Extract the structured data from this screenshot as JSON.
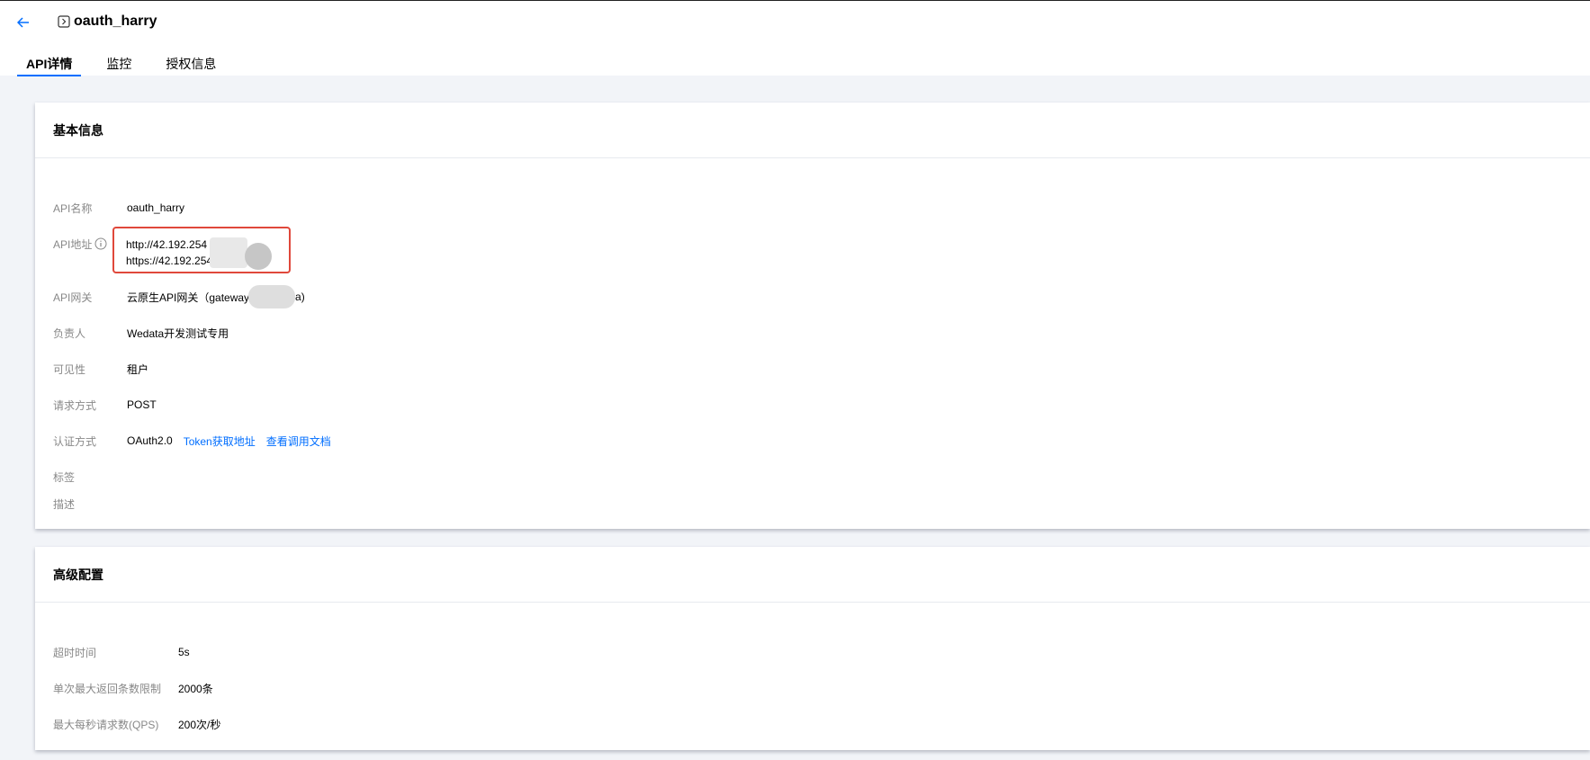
{
  "header": {
    "back_icon": "arrow-left-icon",
    "title_icon": "api-square-icon",
    "title": "oauth_harry"
  },
  "tabs": [
    {
      "label": "API详情",
      "active": true
    },
    {
      "label": "监控",
      "active": false
    },
    {
      "label": "授权信息",
      "active": false
    }
  ],
  "basic_info": {
    "title": "基本信息",
    "api_name": {
      "label": "API名称",
      "value": "oauth_harry"
    },
    "api_address": {
      "label": "API地址",
      "info_icon": "info-circle-icon",
      "http": "http://42.192.254",
      "https": "https://42.192.254"
    },
    "gateway": {
      "label": "API网关",
      "value": "云原生API网关（gateway",
      "suffix": "a)"
    },
    "owner": {
      "label": "负责人",
      "value": "Wedata开发测试专用"
    },
    "visibility": {
      "label": "可见性",
      "value": "租户"
    },
    "method": {
      "label": "请求方式",
      "value": "POST"
    },
    "auth": {
      "label": "认证方式",
      "value": "OAuth2.0",
      "token_link": "Token获取地址",
      "doc_link": "查看调用文档"
    },
    "tags": {
      "label": "标签"
    },
    "desc": {
      "label": "描述"
    }
  },
  "advanced": {
    "title": "高级配置",
    "timeout": {
      "label": "超时时间",
      "value": "5s"
    },
    "max_rows": {
      "label": "单次最大返回条数限制",
      "value": "2000条"
    },
    "qps": {
      "label": "最大每秒请求数(QPS)",
      "value": "200次/秒"
    }
  },
  "colors": {
    "accent": "#006eff",
    "highlight_box": "#e0483b",
    "page_bg": "#f2f4f8"
  }
}
